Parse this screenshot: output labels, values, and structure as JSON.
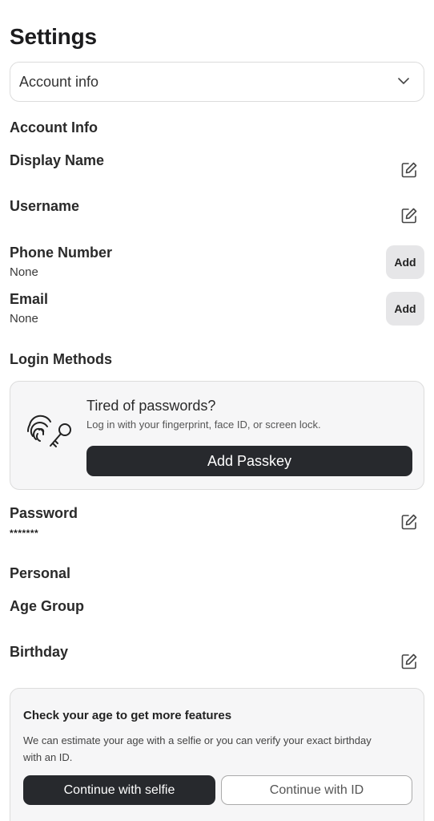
{
  "header": {
    "title": "Settings"
  },
  "section_select": {
    "value": "Account info"
  },
  "account_info": {
    "heading": "Account Info",
    "display_name": {
      "label": "Display Name"
    },
    "username": {
      "label": "Username"
    },
    "phone": {
      "label": "Phone Number",
      "value": "None",
      "action": "Add"
    },
    "email": {
      "label": "Email",
      "value": "None",
      "action": "Add"
    }
  },
  "login_methods": {
    "heading": "Login Methods",
    "passkey": {
      "title": "Tired of passwords?",
      "description": "Log in with your fingerprint, face ID, or screen lock.",
      "button": "Add Passkey",
      "icon": "fingerprint-key-icon"
    },
    "password": {
      "label": "Password",
      "value": "*******"
    }
  },
  "personal": {
    "heading": "Personal",
    "age_group": {
      "label": "Age Group"
    },
    "birthday": {
      "label": "Birthday"
    },
    "age_check": {
      "title": "Check your age to get more features",
      "description": "We can estimate your age with a selfie or you can verify your exact birthday with an ID.",
      "selfie_button": "Continue with selfie",
      "id_button": "Continue with ID"
    }
  },
  "icons": {
    "edit": "edit-icon",
    "chevron": "chevron-down-icon"
  },
  "colors": {
    "dark_button": "#27292d",
    "card_bg": "#f6f6f7",
    "add_button_bg": "#e6e6e8"
  }
}
